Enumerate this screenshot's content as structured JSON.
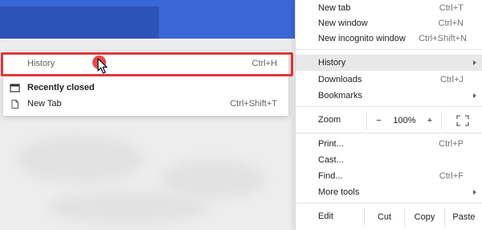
{
  "history_submenu": {
    "history": {
      "label": "History",
      "shortcut": "Ctrl+H"
    },
    "recently_closed": "Recently closed",
    "items": [
      {
        "label": "New Tab",
        "shortcut": "Ctrl+Shift+T"
      }
    ]
  },
  "menu": {
    "new_tab": {
      "label": "New tab",
      "shortcut": "Ctrl+T"
    },
    "new_window": {
      "label": "New window",
      "shortcut": "Ctrl+N"
    },
    "new_incognito": {
      "label": "New incognito window",
      "shortcut": "Ctrl+Shift+N"
    },
    "history": {
      "label": "History"
    },
    "downloads": {
      "label": "Downloads",
      "shortcut": "Ctrl+J"
    },
    "bookmarks": {
      "label": "Bookmarks"
    },
    "zoom": {
      "label": "Zoom",
      "minus": "−",
      "value": "100%",
      "plus": "+"
    },
    "print": {
      "label": "Print...",
      "shortcut": "Ctrl+P"
    },
    "cast": {
      "label": "Cast..."
    },
    "find": {
      "label": "Find...",
      "shortcut": "Ctrl+F"
    },
    "more_tools": {
      "label": "More tools"
    },
    "edit": {
      "label": "Edit",
      "cut": "Cut",
      "copy": "Copy",
      "paste": "Paste"
    }
  },
  "colors": {
    "header_blue": "#3b67d6",
    "highlight_red": "#e0383a",
    "active_row": "#e8e8e8"
  }
}
